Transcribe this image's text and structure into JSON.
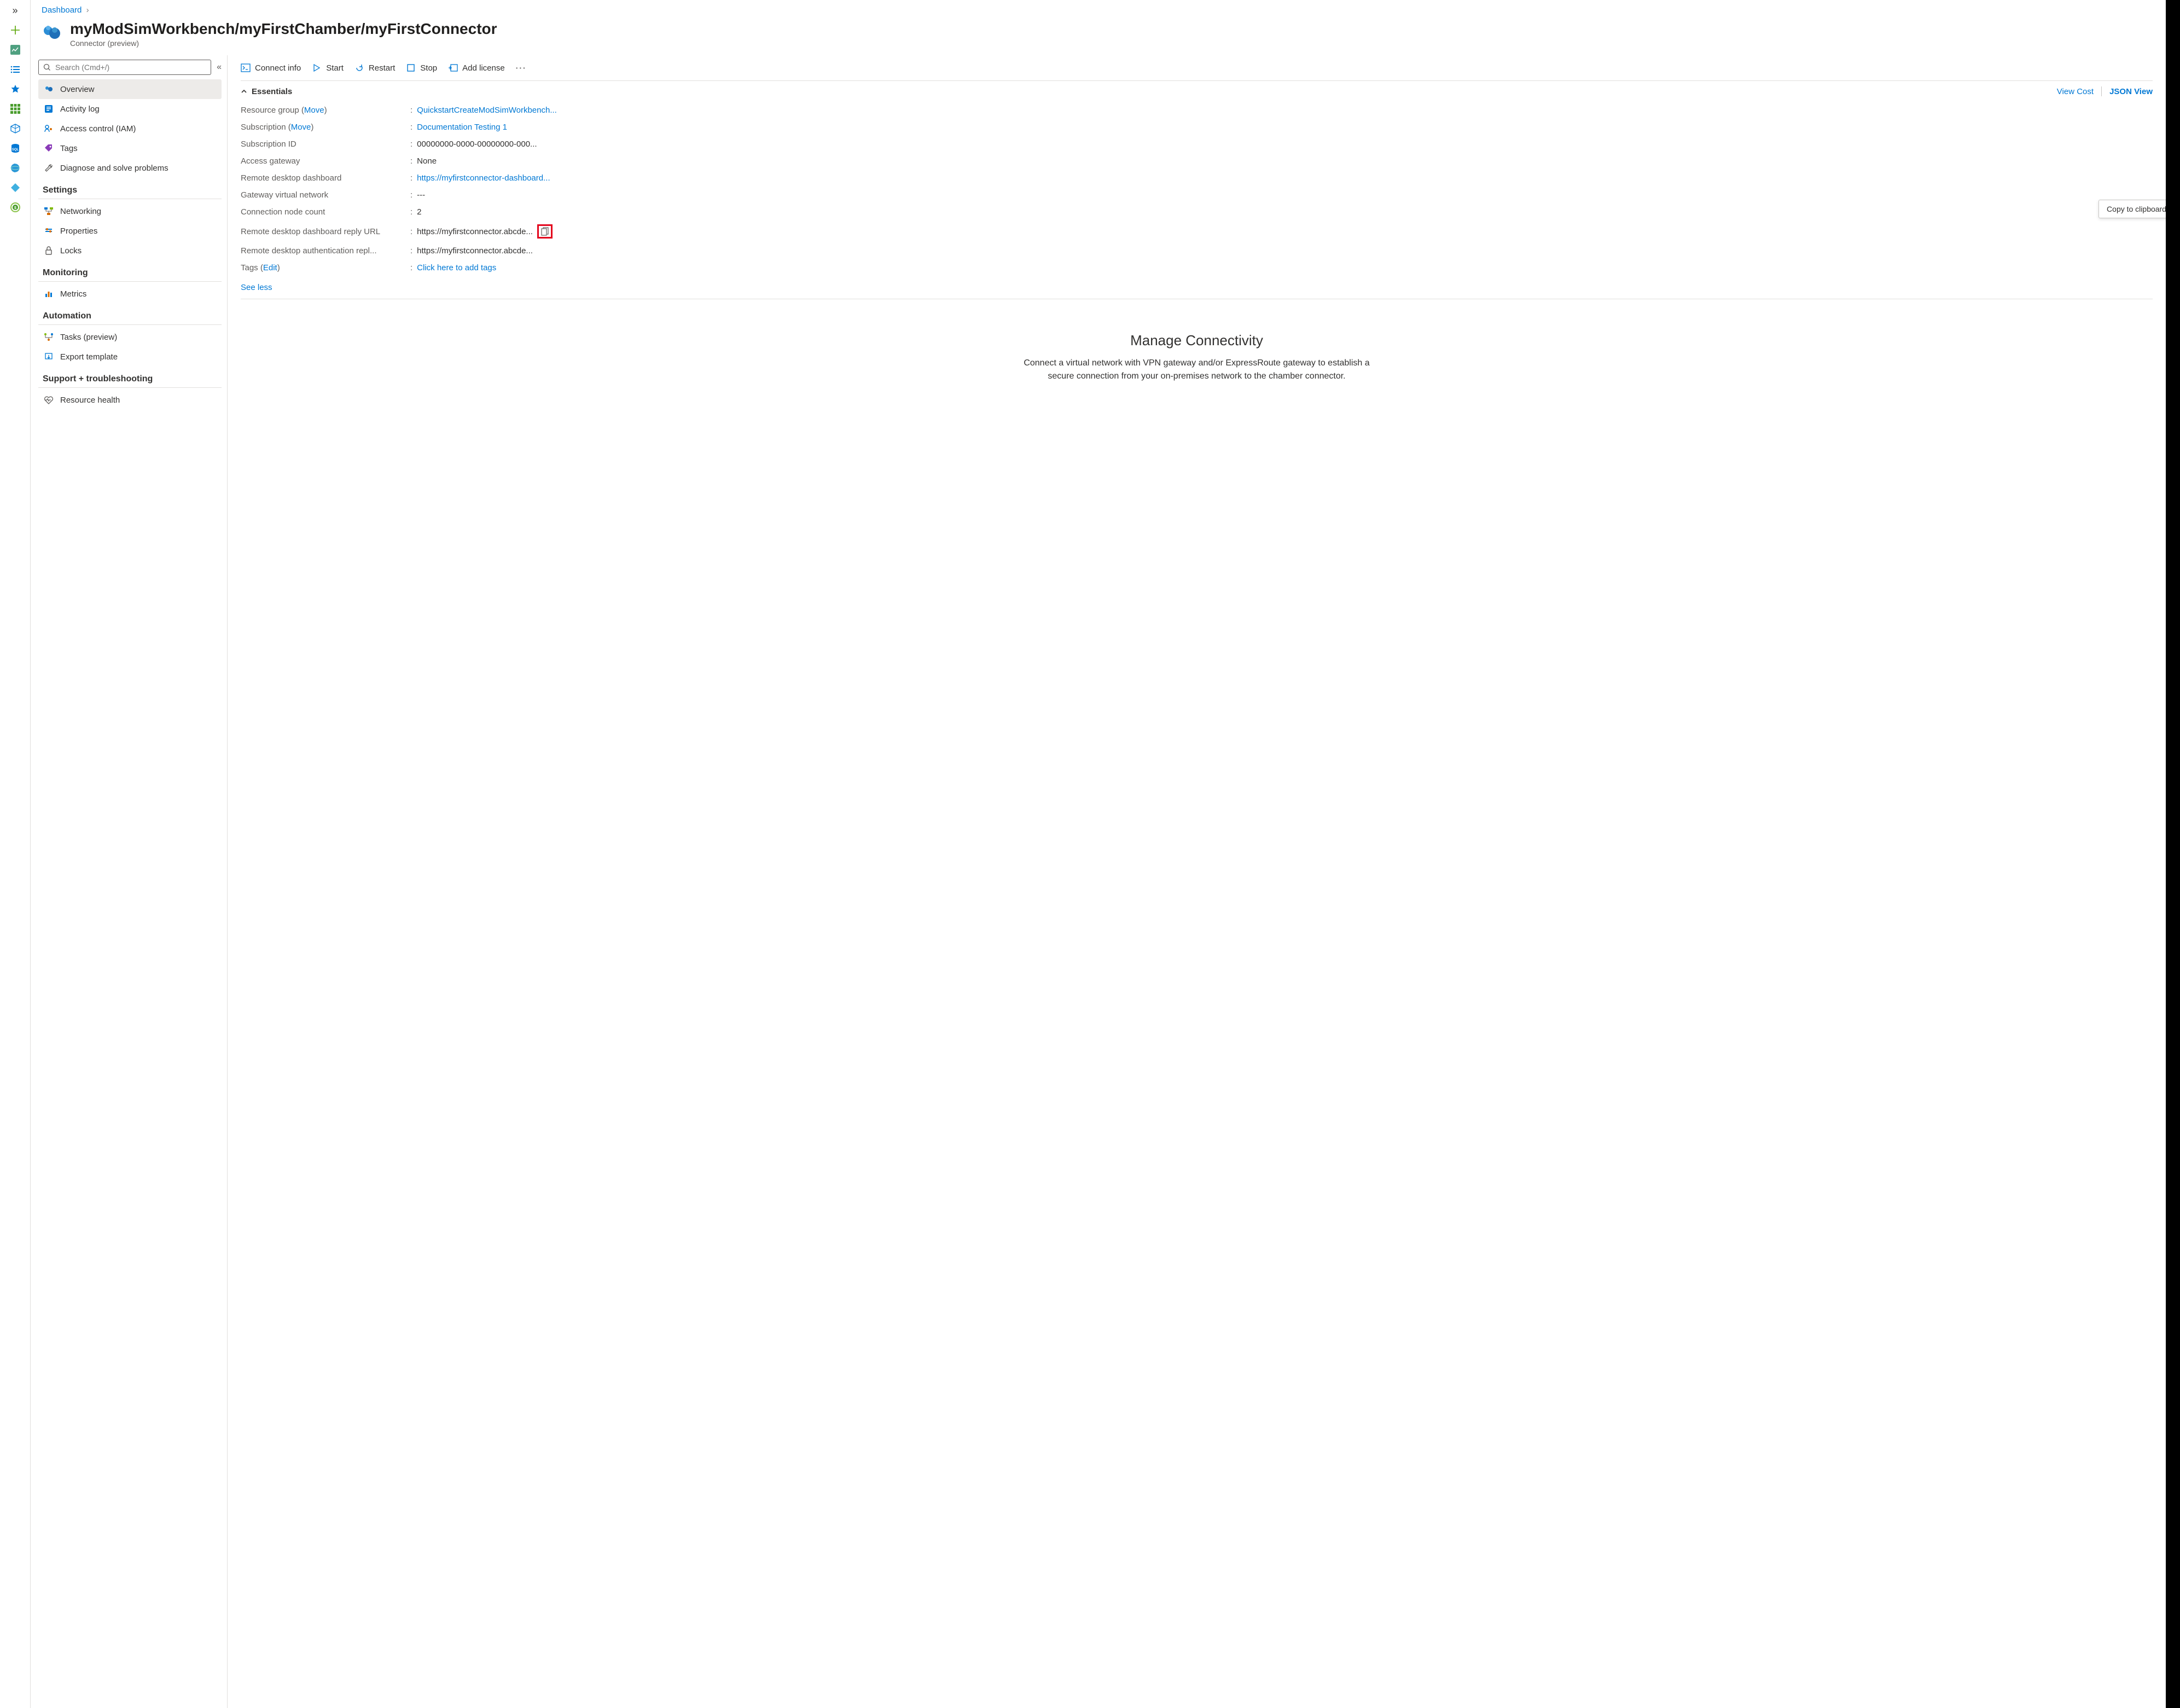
{
  "breadcrumb": {
    "root": "Dashboard"
  },
  "page": {
    "title": "myModSimWorkbench/myFirstChamber/myFirstConnector",
    "subtitle": "Connector (preview)"
  },
  "search": {
    "placeholder": "Search (Cmd+/)"
  },
  "nav": {
    "top": [
      {
        "label": "Overview"
      },
      {
        "label": "Activity log"
      },
      {
        "label": "Access control (IAM)"
      },
      {
        "label": "Tags"
      },
      {
        "label": "Diagnose and solve problems"
      }
    ],
    "settings_hdr": "Settings",
    "settings": [
      {
        "label": "Networking"
      },
      {
        "label": "Properties"
      },
      {
        "label": "Locks"
      }
    ],
    "monitoring_hdr": "Monitoring",
    "monitoring": [
      {
        "label": "Metrics"
      }
    ],
    "automation_hdr": "Automation",
    "automation": [
      {
        "label": "Tasks (preview)"
      },
      {
        "label": "Export template"
      }
    ],
    "support_hdr": "Support + troubleshooting",
    "support": [
      {
        "label": "Resource health"
      }
    ]
  },
  "toolbar": {
    "connect": "Connect info",
    "start": "Start",
    "restart": "Restart",
    "stop": "Stop",
    "addlicense": "Add license"
  },
  "essentials": {
    "title": "Essentials",
    "viewcost": "View Cost",
    "jsonview": "JSON View",
    "rows": [
      {
        "label": "Resource group",
        "move": "Move",
        "value": "QuickstartCreateModSimWorkbench...",
        "link": true
      },
      {
        "label": "Subscription",
        "move": "Move",
        "value": "Documentation Testing 1",
        "link": true
      },
      {
        "label": "Subscription ID",
        "value": "00000000-0000-00000000-000..."
      },
      {
        "label": "Access gateway",
        "value": "None"
      },
      {
        "label": "Remote desktop dashboard",
        "value": "https://myfirstconnector-dashboard...",
        "link": true
      },
      {
        "label": "Gateway virtual network",
        "value": "---"
      },
      {
        "label": "Connection node count",
        "value": "2"
      },
      {
        "label": "Remote desktop dashboard reply URL",
        "value": "https://myfirstconnector.abcde...",
        "copy": true
      },
      {
        "label": "Remote desktop authentication repl...",
        "value": "https://myfirstconnector.abcde..."
      },
      {
        "label": "Tags",
        "edit": "Edit",
        "value": "Click here to add tags",
        "link": true
      }
    ],
    "seeless": "See less"
  },
  "tooltip": "Copy to clipboard",
  "manage": {
    "title": "Manage Connectivity",
    "desc": "Connect a virtual network with VPN gateway and/or ExpressRoute gateway to establish a secure connection from your on-premises network to the chamber connector."
  }
}
